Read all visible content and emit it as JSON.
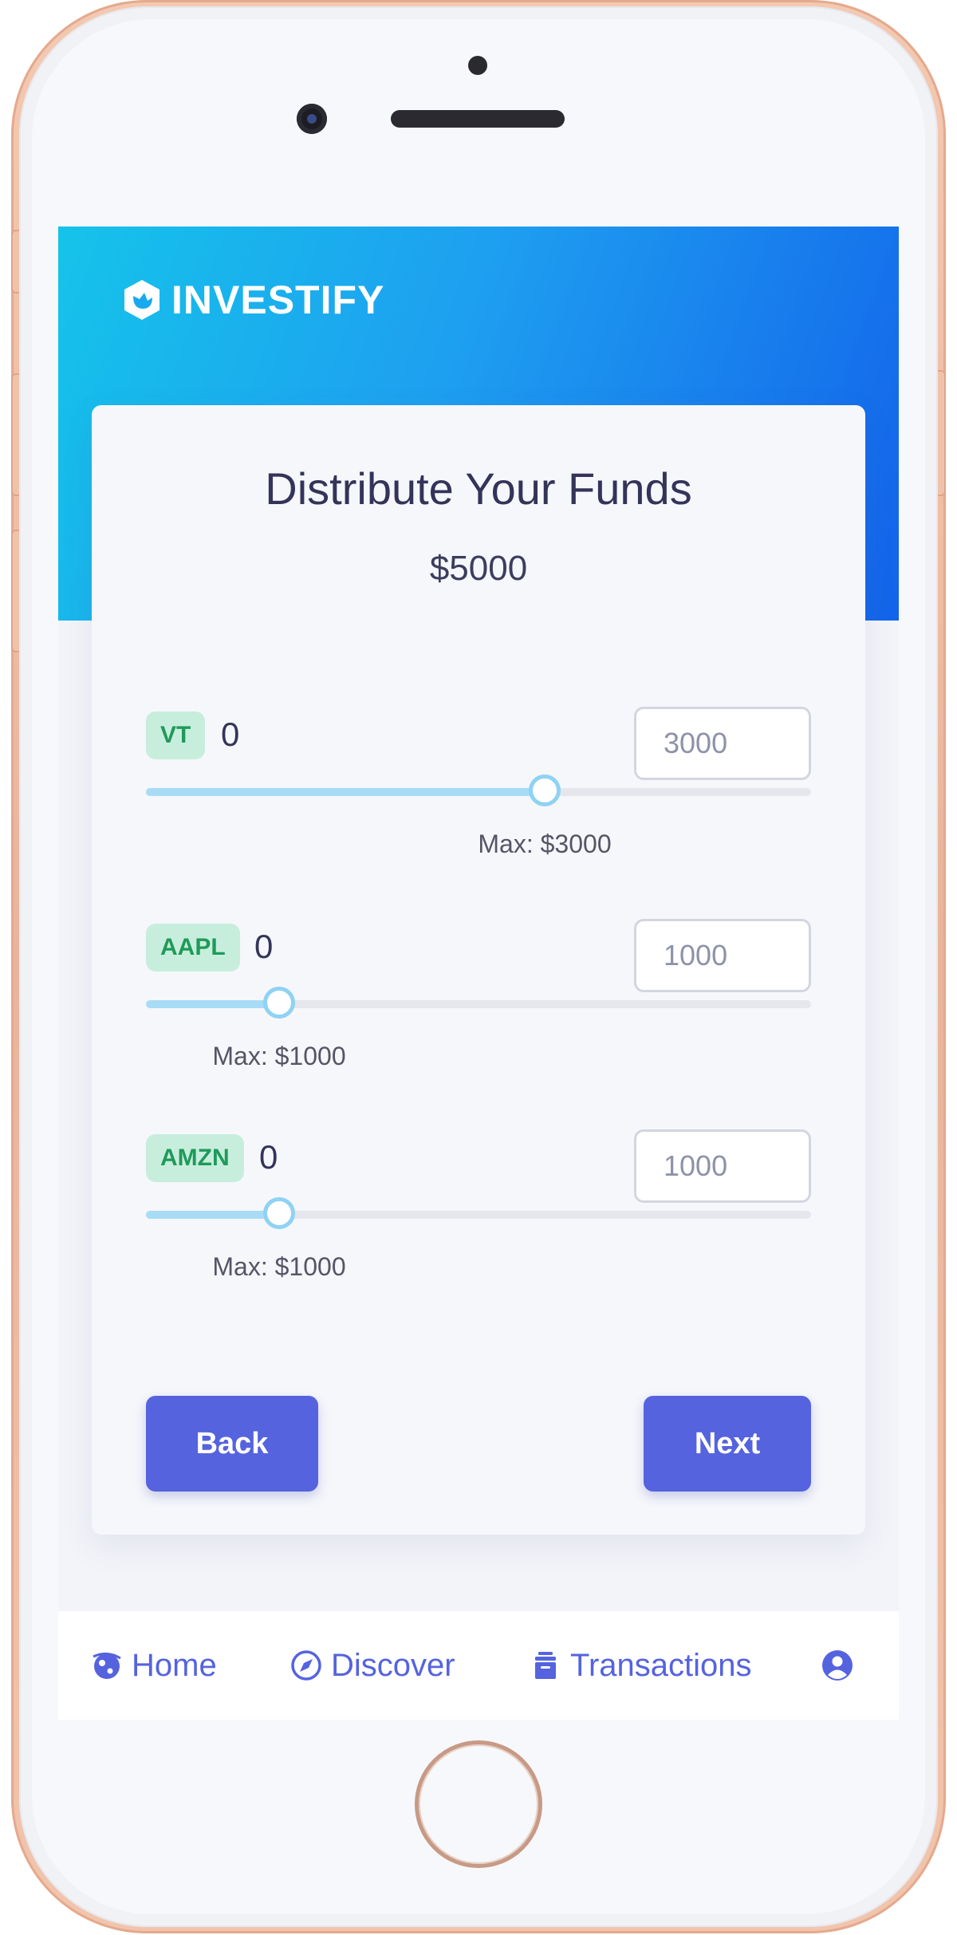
{
  "brand": {
    "name": "INVESTIFY"
  },
  "card": {
    "title": "Distribute Your Funds",
    "total": "$5000"
  },
  "allocations": [
    {
      "ticker": "VT",
      "value": "0",
      "input_placeholder": "3000",
      "max_label": "Max: $3000",
      "slider_fraction": 0.6
    },
    {
      "ticker": "AAPL",
      "value": "0",
      "input_placeholder": "1000",
      "max_label": "Max: $1000",
      "slider_fraction": 0.2
    },
    {
      "ticker": "AMZN",
      "value": "0",
      "input_placeholder": "1000",
      "max_label": "Max: $1000",
      "slider_fraction": 0.2
    }
  ],
  "actions": {
    "back_label": "Back",
    "next_label": "Next"
  },
  "tabbar": {
    "items": [
      {
        "label": "Home",
        "icon": "home-globe-icon"
      },
      {
        "label": "Discover",
        "icon": "compass-icon"
      },
      {
        "label": "Transactions",
        "icon": "archive-box-icon"
      },
      {
        "label": "",
        "icon": "user-circle-icon"
      }
    ]
  },
  "colors": {
    "primary": "#5563de",
    "hero_start": "#15c3ea",
    "hero_end": "#1363ea",
    "ticker_bg": "#c7eedd",
    "ticker_text": "#1f9a5a",
    "slider_fill": "#a8dcf6"
  }
}
